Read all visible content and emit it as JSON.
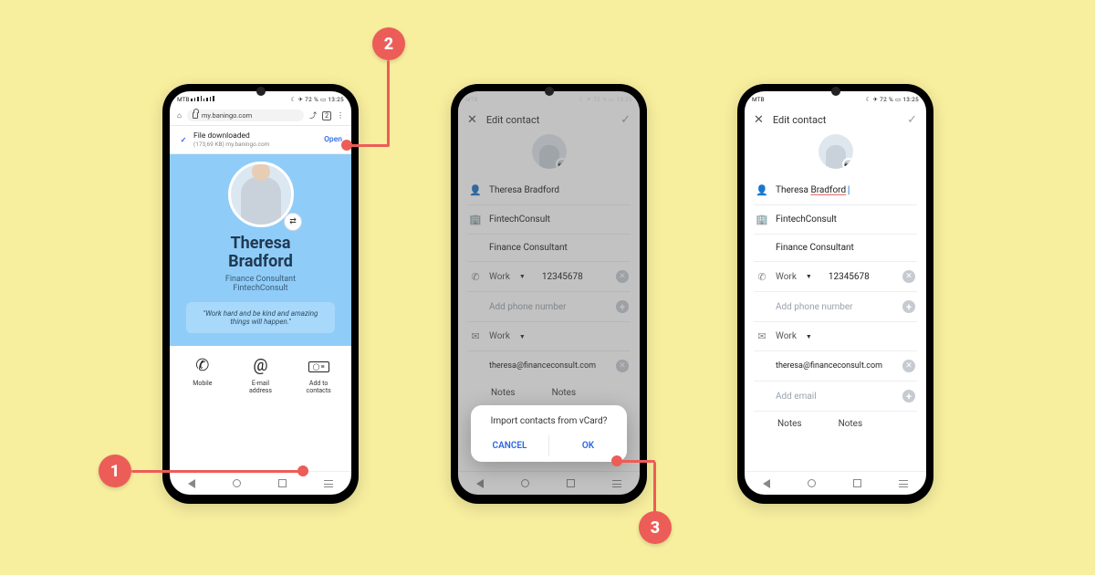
{
  "callouts": {
    "one": "1",
    "two": "2",
    "three": "3"
  },
  "statusbar": {
    "carrier": "MTB",
    "battery": "72 %",
    "time": "13:25"
  },
  "phoneA": {
    "browser": {
      "url": "my.baningo.com"
    },
    "toast": {
      "title": "File downloaded",
      "subtitle": "(173,69 KB) my.baningo.com",
      "action": "Open"
    },
    "profile": {
      "name_line1": "Theresa",
      "name_line2": "Bradford",
      "title": "Finance Consultant",
      "company": "FintechConsult",
      "quote": "\"Work hard and be kind and amazing things will happen.\""
    },
    "actions": {
      "mobile": "Mobile",
      "email_l1": "E-mail",
      "email_l2": "address",
      "add_l1": "Add to",
      "add_l2": "contacts"
    }
  },
  "edit": {
    "header": "Edit contact",
    "name": "Theresa Bradford",
    "name_first": "Theresa ",
    "name_last": "Bradford",
    "company": "FintechConsult",
    "job": "Finance Consultant",
    "phone_label": "Work",
    "phone_value": "12345678",
    "phone_add": "Add phone number",
    "email_label": "Work",
    "email_value_trunc": "theresa@financeconsult.com",
    "email_value": "theresa@financeconsult.com",
    "email_add": "Add email",
    "notes": "Notes"
  },
  "modal": {
    "title": "Import contacts from vCard?",
    "cancel": "CANCEL",
    "ok": "OK"
  }
}
